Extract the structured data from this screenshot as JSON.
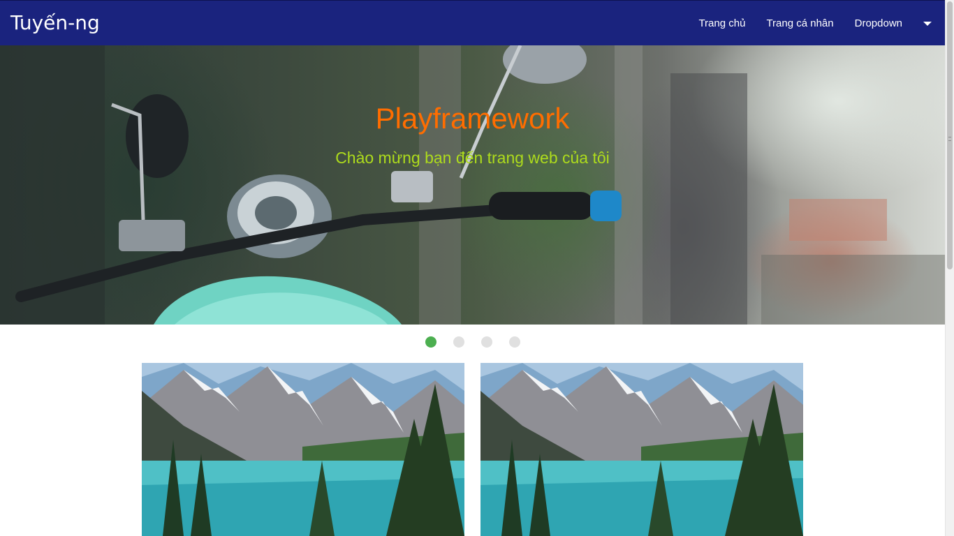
{
  "navbar": {
    "brand": "Tuyến-ng",
    "links": [
      {
        "label": "Trang chủ"
      },
      {
        "label": "Trang cá nhân"
      },
      {
        "label": "Dropdown"
      }
    ],
    "color": "#1a237e"
  },
  "hero": {
    "title": "Playframework",
    "subtitle": "Chào mừng bạn đến trang web của tôi",
    "title_color": "#ff6d00",
    "subtitle_color": "#aedc1c"
  },
  "carousel": {
    "slide_count": 4,
    "active_index": 0,
    "active_color": "#4caf50"
  },
  "gallery": {
    "cards": [
      {
        "image": "mountain-lake-photo"
      },
      {
        "image": "mountain-lake-photo"
      }
    ]
  }
}
